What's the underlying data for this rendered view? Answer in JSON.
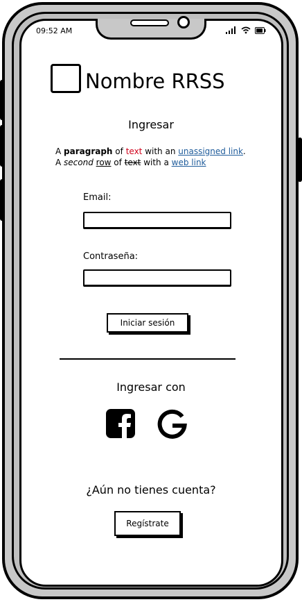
{
  "status": {
    "time": "09:52 AM"
  },
  "brand": {
    "title": "Nombre RRSS"
  },
  "login": {
    "heading": "Ingresar"
  },
  "paragraph": {
    "line1": {
      "prefix": "A ",
      "bold": "paragraph",
      "mid1": " of ",
      "red": "text",
      "mid2": " with an ",
      "link": "unassigned link",
      "end": "."
    },
    "line2": {
      "prefix": "A ",
      "italic": "second",
      "sp1": " ",
      "underlined": "row",
      "mid1": " of ",
      "strike": "text",
      "mid2": " with a ",
      "link": "web link"
    }
  },
  "form": {
    "email_label": "Email:",
    "email_value": "",
    "password_label": "Contraseña:",
    "password_value": "",
    "submit_label": "Iniciar sesión"
  },
  "social": {
    "heading": "Ingresar con",
    "providers": [
      "facebook",
      "google"
    ]
  },
  "register": {
    "prompt": "¿Aún no tienes cuenta?",
    "button_label": "Regístrate"
  },
  "colors": {
    "link": "#1f5c9b",
    "emphasis": "#d0021b",
    "frame": "#c8c8c8"
  }
}
